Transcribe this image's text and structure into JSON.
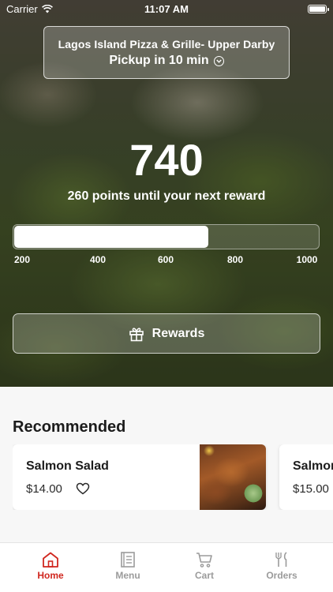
{
  "status_bar": {
    "carrier": "Carrier",
    "time": "11:07 AM"
  },
  "store": {
    "name": "Lagos Island Pizza & Grille- Upper Darby",
    "pickup": "Pickup in 10 min"
  },
  "rewards": {
    "points": "740",
    "message": "260 points until your next reward",
    "progress_fraction": 0.64,
    "ticks": [
      "200",
      "400",
      "600",
      "800",
      "1000"
    ],
    "button_label": "Rewards"
  },
  "recommended": {
    "title": "Recommended",
    "items": [
      {
        "name": "Salmon Salad",
        "price": "$14.00"
      },
      {
        "name": "Salmon",
        "price": "$15.00"
      }
    ]
  },
  "tabs": [
    {
      "label": "Home",
      "icon": "home-icon",
      "active": true
    },
    {
      "label": "Menu",
      "icon": "menu-icon",
      "active": false
    },
    {
      "label": "Cart",
      "icon": "cart-icon",
      "active": false
    },
    {
      "label": "Orders",
      "icon": "orders-icon",
      "active": false
    }
  ],
  "colors": {
    "accent": "#d0261e",
    "inactive": "#9b9b9b"
  }
}
